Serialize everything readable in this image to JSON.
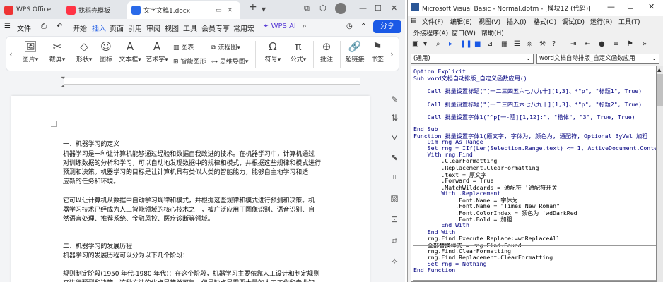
{
  "wps": {
    "tabs": [
      {
        "label": "WPS Office",
        "icon": "wps-logo"
      },
      {
        "label": "找稻壳模板",
        "icon": "docer-logo"
      },
      {
        "label": "文字文稿1.docx",
        "icon": "writer-logo"
      }
    ],
    "new_tab": "+",
    "menu": [
      "文件",
      "开始",
      "插入",
      "页面",
      "引用",
      "审阅",
      "视图",
      "工具",
      "会员专享",
      "常用宏",
      "WPS AI"
    ],
    "active_menu": "插入",
    "share": "分享",
    "ribbon": {
      "items": [
        "图片",
        "截屏",
        "形状",
        "图标",
        "文本框",
        "艺术字",
        "符号",
        "公式",
        "批注",
        "超链接",
        "书签"
      ],
      "small": [
        "图表",
        "流程图",
        "智能图形",
        "思维导图"
      ]
    },
    "page_lines": [
      "一、机器学习的定义",
      "机器学习是一种让计算机能够通过经验和数据自我改进的技术。在机器学习中，计算机通过",
      "对训练数据的分析和学习，可以自动地发现数据中的规律和模式，并根据这些规律和模式进行",
      "预测和决策。机器学习的目标是让计算机具有类似人类的智能能力，能够自主地学习和适",
      "应新的任务和环境。",
      "",
      "它可以让计算机从数据中自动学习规律和模式，并根据这些规律和模式进行预测和决策。机",
      "器学习技术已经成为人工智能领域的核心技术之一，被广泛应用于图像识别、语音识别、自",
      "然语言处理、推荐系统、金融风控、医疗诊断等领域。",
      "",
      "",
      "二、机器学习的发展历程",
      "机器学习的发展历程可以分为以下几个阶段：",
      "",
      "规则制定阶段(1950 年代-1980 年代)：在这个阶段，机器学习主要依靠人工设计和制定规则",
      "来进行预测和决策。这种方法的优点是简单可靠，但是缺点是需要大量的人工工作和专业知"
    ]
  },
  "vbe": {
    "title": "Microsoft Visual Basic - Normal.dotm - [模块12 (代码)]",
    "menu_row1": [
      "文件(F)",
      "编辑(E)",
      "视图(V)",
      "插入(I)",
      "格式(O)",
      "调试(D)",
      "运行(R)",
      "工具(T)"
    ],
    "menu_row2": [
      "外接程序(A)",
      "窗口(W)",
      "帮助(H)"
    ],
    "object_combo": "(通用)",
    "proc_combo": "word文档自动排版_自定义函数应用",
    "code_lines": [
      "Option Explicit",
      "Sub word文档自动排版_自定义函数应用()",
      "",
      "    Call 批量设置标题(\"[一二三四五六七八九十][1,3]、*\"p\", \"标题1\", True)",
      "",
      "    Call 批量设置标题(\"[一二三四五六七八九十][1,3]、*\"p\", \"标题2\", True)",
      "",
      "    Call 批量设置字体1(\"^p[一-隨][1,12]:\", \"楷体\", \"3\", True, True)",
      "",
      "End Sub",
      "Function 批量设置字体1(原文字, 字体为, 颜色为, 通配符, Optional ByVal 加粗",
      "    Dim rng As Range",
      "    Set rng = IIf(Len(Selection.Range.text) <= 1, ActiveDocument.Conter",
      "    With rng.Find",
      "        .ClearFormatting",
      "        .Replacement.ClearFormatting",
      "        .text = 原文字",
      "        .Forward = True",
      "        .MatchWildcards = 通配符 '通配符开关",
      "        With .Replacement",
      "            .Font.Name = 字体为",
      "            .Font.Name = \"Times New Roman\"",
      "            .Font.ColorIndex = 颜色为 'wdDarkRed",
      "            .Font.Bold = 加粗",
      "        End With",
      "    End With",
      "    rng.Find.Execute Replace:=wdReplaceAll",
      "    全部替换样式 = rng.Find.Found",
      "    rng.Find.ClearFormatting",
      "    rng.Find.Replacement.ClearFormatting",
      "    Set rng = Nothing",
      "End Function",
      "",
      "Function 批量设置标题(原文字, 标题, 通配符)"
    ]
  }
}
